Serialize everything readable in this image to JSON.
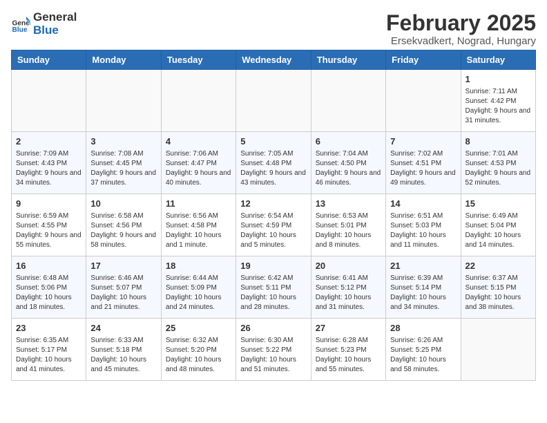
{
  "header": {
    "logo_general": "General",
    "logo_blue": "Blue",
    "title": "February 2025",
    "subtitle": "Ersekvadkert, Nograd, Hungary"
  },
  "weekdays": [
    "Sunday",
    "Monday",
    "Tuesday",
    "Wednesday",
    "Thursday",
    "Friday",
    "Saturday"
  ],
  "weeks": [
    [
      {
        "day": "",
        "info": ""
      },
      {
        "day": "",
        "info": ""
      },
      {
        "day": "",
        "info": ""
      },
      {
        "day": "",
        "info": ""
      },
      {
        "day": "",
        "info": ""
      },
      {
        "day": "",
        "info": ""
      },
      {
        "day": "1",
        "info": "Sunrise: 7:11 AM\nSunset: 4:42 PM\nDaylight: 9 hours and 31 minutes."
      }
    ],
    [
      {
        "day": "2",
        "info": "Sunrise: 7:09 AM\nSunset: 4:43 PM\nDaylight: 9 hours and 34 minutes."
      },
      {
        "day": "3",
        "info": "Sunrise: 7:08 AM\nSunset: 4:45 PM\nDaylight: 9 hours and 37 minutes."
      },
      {
        "day": "4",
        "info": "Sunrise: 7:06 AM\nSunset: 4:47 PM\nDaylight: 9 hours and 40 minutes."
      },
      {
        "day": "5",
        "info": "Sunrise: 7:05 AM\nSunset: 4:48 PM\nDaylight: 9 hours and 43 minutes."
      },
      {
        "day": "6",
        "info": "Sunrise: 7:04 AM\nSunset: 4:50 PM\nDaylight: 9 hours and 46 minutes."
      },
      {
        "day": "7",
        "info": "Sunrise: 7:02 AM\nSunset: 4:51 PM\nDaylight: 9 hours and 49 minutes."
      },
      {
        "day": "8",
        "info": "Sunrise: 7:01 AM\nSunset: 4:53 PM\nDaylight: 9 hours and 52 minutes."
      }
    ],
    [
      {
        "day": "9",
        "info": "Sunrise: 6:59 AM\nSunset: 4:55 PM\nDaylight: 9 hours and 55 minutes."
      },
      {
        "day": "10",
        "info": "Sunrise: 6:58 AM\nSunset: 4:56 PM\nDaylight: 9 hours and 58 minutes."
      },
      {
        "day": "11",
        "info": "Sunrise: 6:56 AM\nSunset: 4:58 PM\nDaylight: 10 hours and 1 minute."
      },
      {
        "day": "12",
        "info": "Sunrise: 6:54 AM\nSunset: 4:59 PM\nDaylight: 10 hours and 5 minutes."
      },
      {
        "day": "13",
        "info": "Sunrise: 6:53 AM\nSunset: 5:01 PM\nDaylight: 10 hours and 8 minutes."
      },
      {
        "day": "14",
        "info": "Sunrise: 6:51 AM\nSunset: 5:03 PM\nDaylight: 10 hours and 11 minutes."
      },
      {
        "day": "15",
        "info": "Sunrise: 6:49 AM\nSunset: 5:04 PM\nDaylight: 10 hours and 14 minutes."
      }
    ],
    [
      {
        "day": "16",
        "info": "Sunrise: 6:48 AM\nSunset: 5:06 PM\nDaylight: 10 hours and 18 minutes."
      },
      {
        "day": "17",
        "info": "Sunrise: 6:46 AM\nSunset: 5:07 PM\nDaylight: 10 hours and 21 minutes."
      },
      {
        "day": "18",
        "info": "Sunrise: 6:44 AM\nSunset: 5:09 PM\nDaylight: 10 hours and 24 minutes."
      },
      {
        "day": "19",
        "info": "Sunrise: 6:42 AM\nSunset: 5:11 PM\nDaylight: 10 hours and 28 minutes."
      },
      {
        "day": "20",
        "info": "Sunrise: 6:41 AM\nSunset: 5:12 PM\nDaylight: 10 hours and 31 minutes."
      },
      {
        "day": "21",
        "info": "Sunrise: 6:39 AM\nSunset: 5:14 PM\nDaylight: 10 hours and 34 minutes."
      },
      {
        "day": "22",
        "info": "Sunrise: 6:37 AM\nSunset: 5:15 PM\nDaylight: 10 hours and 38 minutes."
      }
    ],
    [
      {
        "day": "23",
        "info": "Sunrise: 6:35 AM\nSunset: 5:17 PM\nDaylight: 10 hours and 41 minutes."
      },
      {
        "day": "24",
        "info": "Sunrise: 6:33 AM\nSunset: 5:18 PM\nDaylight: 10 hours and 45 minutes."
      },
      {
        "day": "25",
        "info": "Sunrise: 6:32 AM\nSunset: 5:20 PM\nDaylight: 10 hours and 48 minutes."
      },
      {
        "day": "26",
        "info": "Sunrise: 6:30 AM\nSunset: 5:22 PM\nDaylight: 10 hours and 51 minutes."
      },
      {
        "day": "27",
        "info": "Sunrise: 6:28 AM\nSunset: 5:23 PM\nDaylight: 10 hours and 55 minutes."
      },
      {
        "day": "28",
        "info": "Sunrise: 6:26 AM\nSunset: 5:25 PM\nDaylight: 10 hours and 58 minutes."
      },
      {
        "day": "",
        "info": ""
      }
    ]
  ]
}
